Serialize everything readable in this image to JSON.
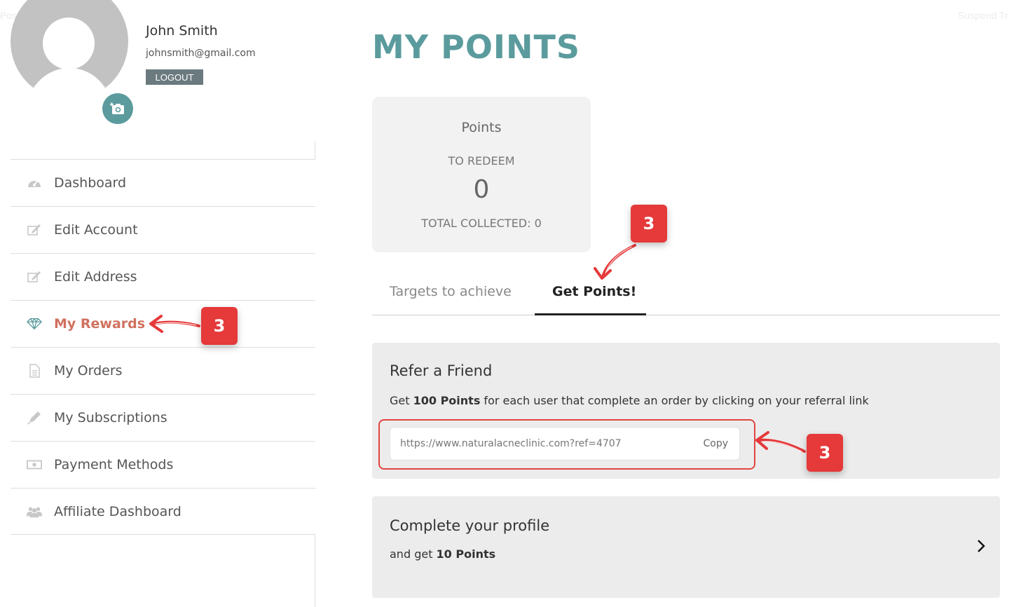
{
  "background_labels": {
    "left": "Post",
    "right": "Suspend Tr"
  },
  "user": {
    "name": "John Smith",
    "email": "johnsmith@gmail.com",
    "logout_label": "LOGOUT"
  },
  "sidebar": {
    "items": [
      {
        "label": "Dashboard",
        "icon": "dashboard-icon",
        "active": false
      },
      {
        "label": "Edit Account",
        "icon": "edit-icon",
        "active": false
      },
      {
        "label": "Edit Address",
        "icon": "edit-icon",
        "active": false
      },
      {
        "label": "My Rewards",
        "icon": "diamond-icon",
        "active": true
      },
      {
        "label": "My Orders",
        "icon": "document-icon",
        "active": false
      },
      {
        "label": "My Subscriptions",
        "icon": "pencil-icon",
        "active": false
      },
      {
        "label": "Payment Methods",
        "icon": "money-icon",
        "active": false
      },
      {
        "label": "Affiliate Dashboard",
        "icon": "users-icon",
        "active": false
      }
    ]
  },
  "main": {
    "title": "MY POINTS",
    "points_card": {
      "title": "Points",
      "subtitle": "TO REDEEM",
      "value": "0",
      "total_label": "TOTAL COLLECTED: 0"
    },
    "tabs": [
      {
        "label": "Targets to achieve",
        "active": false
      },
      {
        "label": "Get Points!",
        "active": true
      }
    ],
    "refer": {
      "title": "Refer a Friend",
      "desc_prefix": "Get ",
      "desc_bold": "100 Points",
      "desc_suffix": " for each user that complete an order by clicking on your referral link",
      "link": "https://www.naturalacneclinic.com?ref=4707",
      "copy_label": "Copy"
    },
    "profile": {
      "title": "Complete your profile",
      "desc_prefix": "and get ",
      "desc_bold": "10 Points"
    }
  },
  "annotations": {
    "badges": [
      "3",
      "3",
      "3"
    ],
    "color": "#e5393a"
  },
  "colors": {
    "accent": "#5b9b9d",
    "active_menu": "#d0715f",
    "logout_bg": "#6b7a7e"
  }
}
